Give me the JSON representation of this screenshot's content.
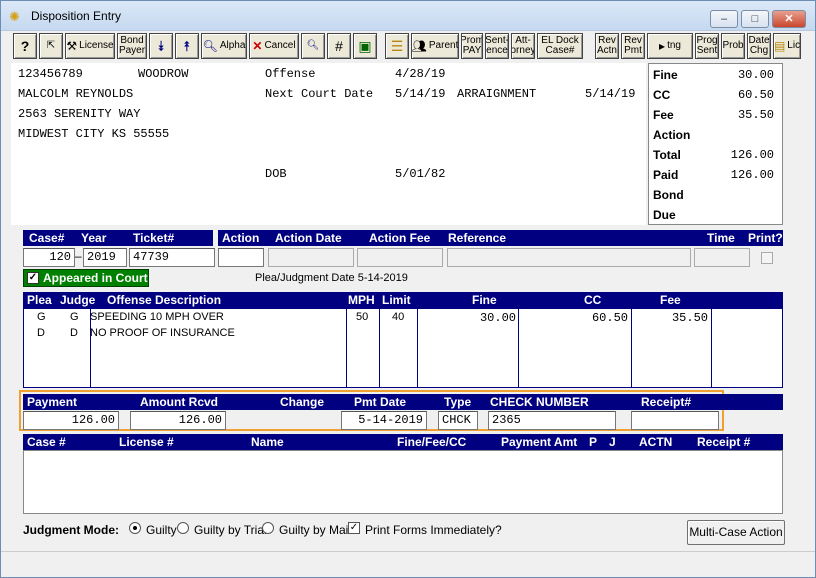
{
  "window": {
    "title": "Disposition Entry",
    "minimize": "–",
    "maximize": "□",
    "close": "✕"
  },
  "toolbar": {
    "help": "?",
    "license": "License",
    "bond_payer_1": "Bond",
    "bond_payer_2": "Payer",
    "alpha": "Alpha",
    "cancel": "Cancel",
    "number": "#",
    "parent": "Parent",
    "prom_pay_1": "Prom",
    "prom_pay_2": "PAY",
    "sentence_1": "Sent-",
    "sentence_2": "ence",
    "attorney_1": "Att-",
    "attorney_2": "orney",
    "el_dock_1": "EL Dock",
    "el_dock_2": "Case#",
    "rev_actn_1": "Rev",
    "rev_actn_2": "Actn",
    "rev_pmt_1": "Rev",
    "rev_pmt_2": "Pmt",
    "tng": "tng",
    "prog_sent_1": "Prog",
    "prog_sent_2": "Sent",
    "prob": "Prob",
    "date_chg_1": "Date",
    "date_chg_2": "Chg",
    "lic": "Lic"
  },
  "defendant": {
    "id": "123456789",
    "first": "WOODROW",
    "name": "MALCOLM REYNOLDS",
    "address1": "2563 SERENITY WAY",
    "address2": "MIDWEST CITY KS 55555",
    "offense_label": "Offense",
    "offense_date": "4/28/19",
    "next_court_label": "Next Court Date",
    "next_court_date": "5/14/19",
    "next_court_type": "ARRAIGNMENT",
    "next_court_date2": "5/14/19",
    "dob_label": "DOB",
    "dob": "5/01/82"
  },
  "summary": {
    "fine_label": "Fine",
    "fine": "30.00",
    "cc_label": "CC",
    "cc": "60.50",
    "fee_label": "Fee",
    "fee": "35.50",
    "action_label": "Action",
    "total_label": "Total",
    "total": "126.00",
    "paid_label": "Paid",
    "paid": "126.00",
    "bond_label": "Bond",
    "due_label": "Due"
  },
  "case": {
    "h_case": "Case#",
    "h_year": "Year",
    "h_ticket": "Ticket#",
    "case_num": "120",
    "year": "2019",
    "ticket": "47739",
    "h_action": "Action",
    "h_action_date": "Action Date",
    "h_action_fee": "Action Fee",
    "h_reference": "Reference",
    "h_time": "Time",
    "h_print": "Print?"
  },
  "appeared_in_court": "Appeared in Court",
  "plea_date": "Plea/Judgment Date 5-14-2019",
  "offense_table": {
    "headers": {
      "plea": "Plea",
      "judge": "Judge",
      "desc": "Offense Description",
      "mph": "MPH",
      "limit": "Limit",
      "fine": "Fine",
      "cc": "CC",
      "fee": "Fee"
    },
    "rows": [
      {
        "plea": "G",
        "judge": "G",
        "desc": "SPEEDING 10 MPH OVER",
        "mph": "50",
        "limit": "40",
        "fine": "30.00",
        "cc": "60.50",
        "fee": "35.50"
      },
      {
        "plea": "D",
        "judge": "D",
        "desc": "NO PROOF OF INSURANCE",
        "mph": "",
        "limit": "",
        "fine": "",
        "cc": "",
        "fee": ""
      }
    ]
  },
  "payment": {
    "h_payment": "Payment",
    "h_amount": "Amount Rcvd",
    "h_change": "Change",
    "h_pmt_date": "Pmt Date",
    "h_type": "Type",
    "h_check": "CHECK NUMBER",
    "h_receipt": "Receipt#",
    "payment": "126.00",
    "amount": "126.00",
    "pmt_date": "5-14-2019",
    "type": "CHCK",
    "check": "2365"
  },
  "multi_table": {
    "h_case": "Case #",
    "h_license": "License #",
    "h_name": "Name",
    "h_ffc": "Fine/Fee/CC",
    "h_amt": "Payment Amt",
    "h_p": "P",
    "h_j": "J",
    "h_actn": "ACTN",
    "h_receipt": "Receipt #"
  },
  "judgment": {
    "label": "Judgment Mode:",
    "guilty": "Guilty",
    "guilty_trial": "Guilty by Trial",
    "guilty_mail": "Guilty by Mail",
    "print_forms": "Print Forms Immediately?",
    "multi_case": "Multi-Case Action"
  },
  "colors": {
    "header_blue": "#000080",
    "highlight": "#f0a030",
    "appeared_green": "#008000"
  }
}
